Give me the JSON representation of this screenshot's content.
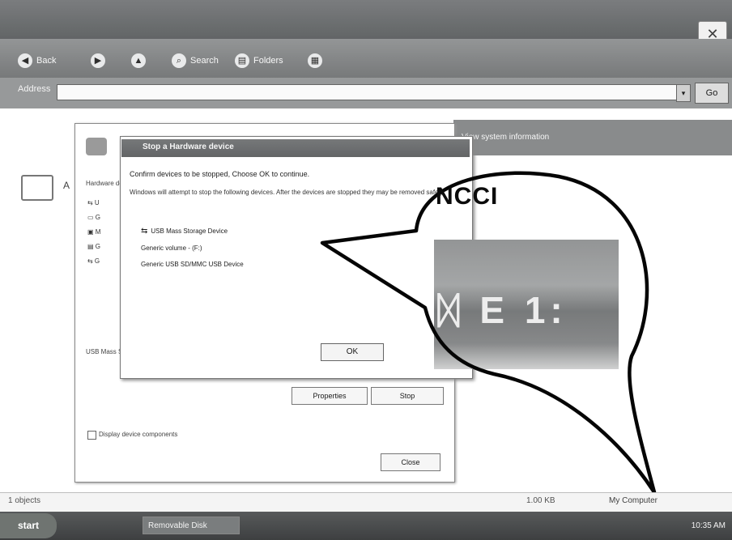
{
  "window": {
    "close_label": "✕"
  },
  "toolbar": {
    "items": [
      {
        "label": "Back",
        "icon": "back-arrow-icon",
        "glyph": "◀"
      },
      {
        "label": "",
        "icon": "forward-arrow-icon",
        "glyph": "▶"
      },
      {
        "label": "",
        "icon": "up-folder-icon",
        "glyph": "▲"
      },
      {
        "label": "Search",
        "icon": "search-icon",
        "glyph": "⌕"
      },
      {
        "label": "Folders",
        "icon": "folders-icon",
        "glyph": "▤"
      },
      {
        "label": "",
        "icon": "views-icon",
        "glyph": "▦"
      }
    ]
  },
  "address": {
    "label": "Address",
    "value": "",
    "go_label": "Go"
  },
  "task_panel": {
    "link": "View system information"
  },
  "back_dialog": {
    "list_label": "Hardware devices:",
    "item_label": "USB Mass Storage Device",
    "properties_label": "Properties",
    "stop_label": "Stop",
    "checkbox_label": "Display device components",
    "close_label": "Close"
  },
  "front_dialog": {
    "title": "Stop a Hardware device",
    "confirm": "Confirm devices to be stopped, Choose OK to continue.",
    "description": "Windows will attempt to stop the following devices. After the devices are stopped they may be removed safely.",
    "devices": [
      {
        "icon": "usb-device-icon",
        "glyph": "⇆",
        "label": "USB Mass Storage Device"
      },
      {
        "icon": "",
        "glyph": "",
        "label": "Generic volume - (F:)"
      },
      {
        "icon": "",
        "glyph": "",
        "label": "Generic USB SD/MMC USB Device"
      }
    ],
    "ok_label": "OK"
  },
  "callout": {
    "caption": "NCCI",
    "zoom_text": "ᛞ E 1:"
  },
  "statusbar": {
    "left": "1 objects",
    "middle": "1.00 KB",
    "right": "My Computer"
  },
  "taskbar": {
    "start_label": "start",
    "task_button": "Removable Disk",
    "clock": "10:35 AM"
  }
}
